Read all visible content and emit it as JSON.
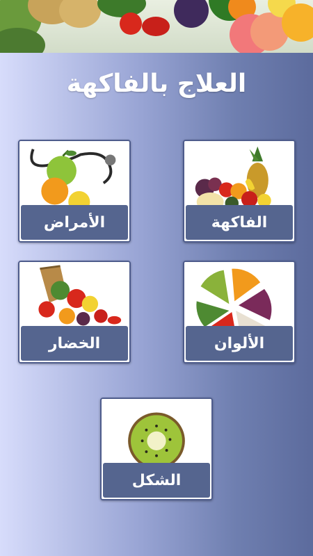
{
  "app": {
    "title": "العلاج بالفاكهة"
  },
  "cards": {
    "fruits": {
      "label": "الفاكهة",
      "icon": "fruit-basket-icon"
    },
    "diseases": {
      "label": "الأمراض",
      "icon": "stethoscope-apple-icon"
    },
    "colors": {
      "label": "الألوان",
      "icon": "color-wheel-fruits-icon"
    },
    "vegetables": {
      "label": "الخضار",
      "icon": "vegetable-basket-icon"
    },
    "shape": {
      "label": "الشكل",
      "icon": "kiwi-slice-icon"
    }
  },
  "theme": {
    "label_bg": "#55658f",
    "card_border": "#4e5c8c",
    "background_left": "#d7dcfb",
    "background_right": "#5c6b9d"
  }
}
